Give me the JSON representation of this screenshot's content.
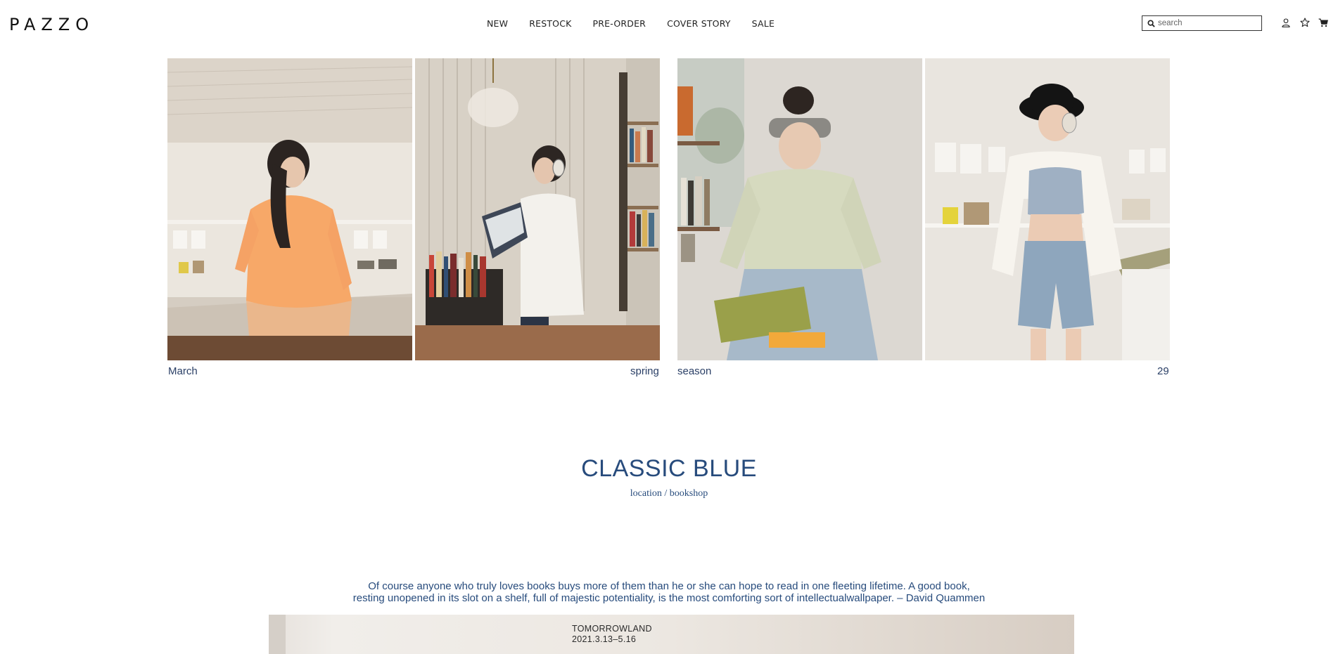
{
  "header": {
    "logo": "PAZZO",
    "nav": [
      "NEW",
      "RESTOCK",
      "PRE-ORDER",
      "COVER STORY",
      "SALE"
    ],
    "search": {
      "placeholder": "search",
      "value": ""
    },
    "icons": [
      "search-icon",
      "user-icon",
      "star-icon",
      "cart-icon"
    ]
  },
  "gallery": {
    "photos": [
      {
        "subject": "woman in oversized orange long sleeve tee in bookshop",
        "colors": [
          "#efe8de",
          "#f8a867"
        ]
      },
      {
        "subject": "woman with headphones reading a book beside bookshelves",
        "colors": [
          "#d9d2c8",
          "#efece6"
        ]
      },
      {
        "subject": "woman in sage green shirt and wide jeans holding green book",
        "colors": [
          "#dedbd5",
          "#d8dcc2"
        ]
      },
      {
        "subject": "woman in black cap, blue crop top and denim shorts",
        "colors": [
          "#eae6e0",
          "#a2b3c6"
        ]
      }
    ],
    "captions": {
      "left_a": "March",
      "left_b": "spring",
      "right_a": "season",
      "right_b": "29"
    }
  },
  "story": {
    "title": "CLASSIC BLUE",
    "subtitle": "location / bookshop",
    "quote_line1": "Of course anyone who truly loves books buys more of them than he or she can hope to read in one fleeting lifetime. A good book,",
    "quote_line2": "resting unopened in its slot on a shelf, full of majestic potentiality, is the most comforting sort of intellectualwallpaper. – David Quammen",
    "banner_line1": "TOMORROWLAND",
    "banner_line2": "2021.3.13–5.16"
  },
  "colors": {
    "accent": "#274b7c",
    "caption": "#2a3f66",
    "text": "#1c1c1c"
  }
}
